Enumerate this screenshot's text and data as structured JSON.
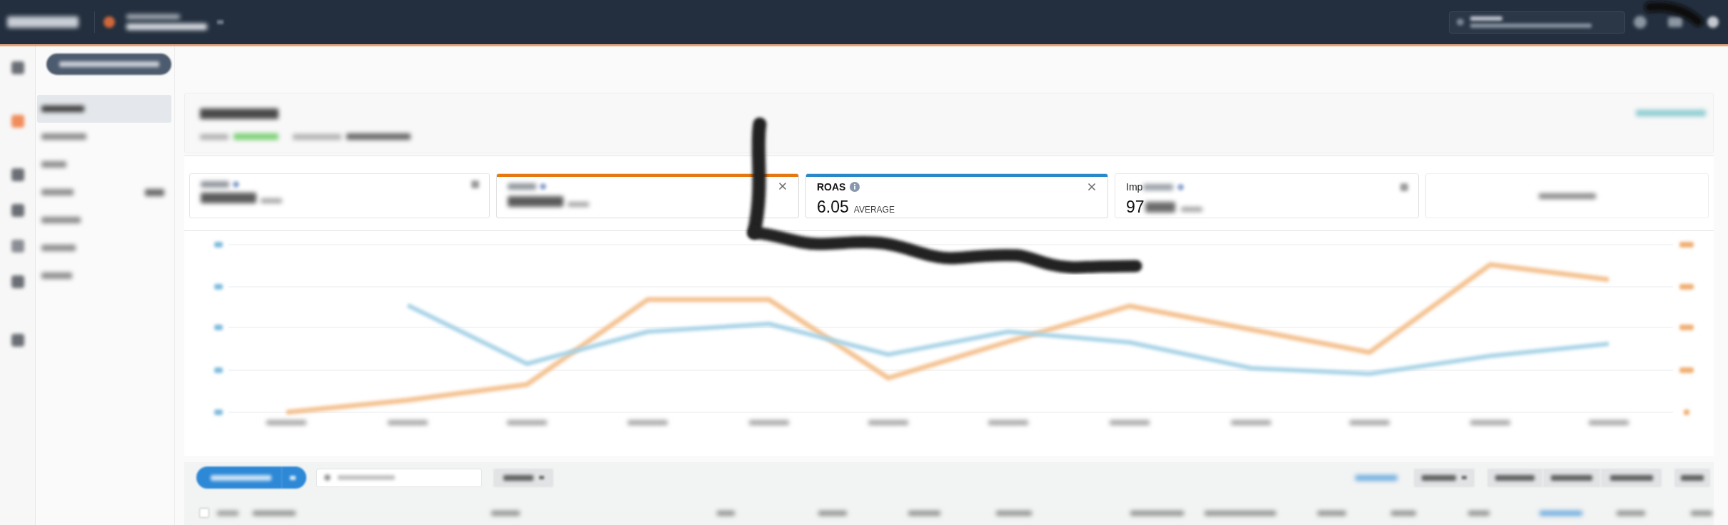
{
  "sidebar": {
    "items": [
      {
        "selected": true,
        "badge": false
      },
      {
        "selected": false,
        "badge": false
      },
      {
        "selected": false,
        "badge": false
      },
      {
        "selected": false,
        "badge": true
      },
      {
        "selected": false,
        "badge": false
      },
      {
        "selected": false,
        "badge": false
      },
      {
        "selected": false,
        "badge": false
      }
    ]
  },
  "metric_cards": [
    {
      "kind": "blurred",
      "selected": false
    },
    {
      "kind": "edge",
      "selected": true,
      "color": "#e47911"
    },
    {
      "kind": "clear",
      "label": "ROAS",
      "value": "6.05",
      "qualifier": "AVERAGE",
      "selected": true,
      "color": "#2b88c8"
    },
    {
      "kind": "cut",
      "label": "Imp",
      "value": "97",
      "selected": false
    }
  ],
  "table": {
    "select_all": {
      "checked": false
    }
  }
}
